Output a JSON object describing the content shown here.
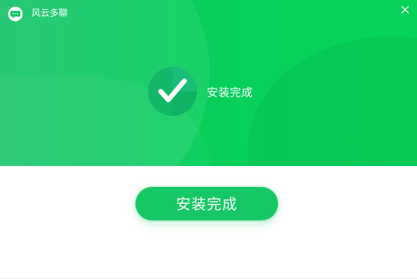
{
  "window": {
    "title": "风云多聊"
  },
  "header": {
    "logo_icon": "chat-bubble-icon",
    "close_icon": "close-icon"
  },
  "status": {
    "icon": "checkmark-icon",
    "text": "安装完成"
  },
  "actions": {
    "finish_label": "安装完成"
  },
  "colors": {
    "brand_green": "#08cf5c",
    "button_green": "#17c765",
    "header_green_light": "#18c46c",
    "header_green_dark": "#07d35a"
  }
}
